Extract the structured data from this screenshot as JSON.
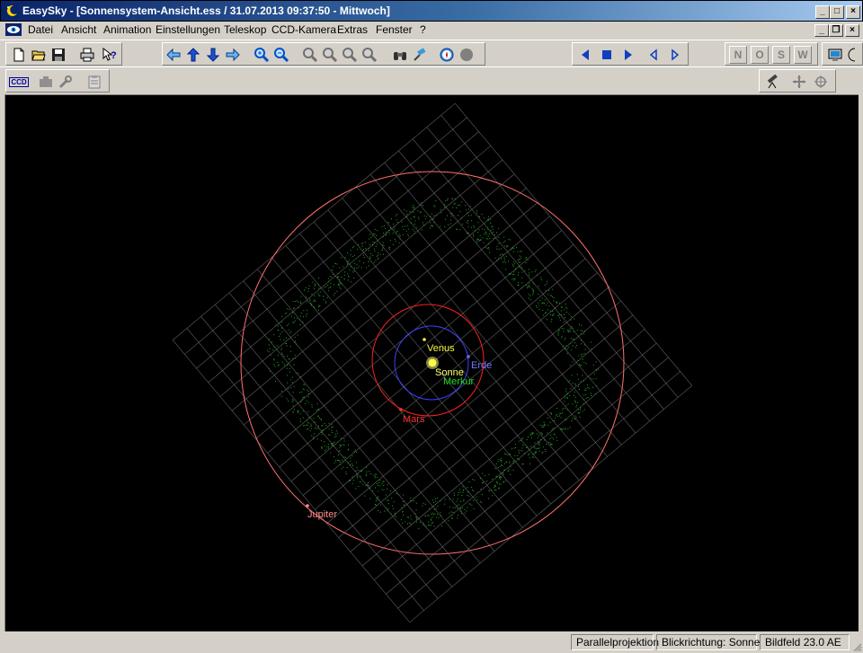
{
  "window": {
    "title": "EasySky - [Sonnensystem-Ansicht.ess / 31.07.2013 09:37:50 - Mittwoch]",
    "controls": [
      "_",
      "□",
      "×"
    ],
    "mdi_controls": [
      "_",
      "❐",
      "×"
    ]
  },
  "menu": {
    "items": [
      {
        "label": "Datei"
      },
      {
        "label": "Ansicht"
      },
      {
        "label": "Animation"
      },
      {
        "label": "Einstellungen"
      },
      {
        "label": "Teleskop"
      },
      {
        "label": "CCD-Kamera"
      },
      {
        "label": "Extras"
      },
      {
        "label": "Fenster"
      },
      {
        "label": "?"
      }
    ]
  },
  "toolbar": {
    "direction_letters": [
      "N",
      "O",
      "S",
      "W"
    ],
    "ccd_label": "CCD"
  },
  "solar_system": {
    "planets": [
      {
        "name": "Venus",
        "color": "#f5f542"
      },
      {
        "name": "Sonne",
        "color": "#ffff66"
      },
      {
        "name": "Erde",
        "color": "#6a6aff"
      },
      {
        "name": "Merkur",
        "color": "#22dd22"
      },
      {
        "name": "Mars",
        "color": "#ff3030"
      },
      {
        "name": "Jupiter",
        "color": "#ff8a8a"
      }
    ],
    "grid_color": "#808080",
    "asteroid_color": "#2aa82a"
  },
  "status": {
    "projection": "Parallelprojektion",
    "view_direction": "Blickrichtung: Sonne",
    "field": "Bildfeld 23.0 AE"
  }
}
